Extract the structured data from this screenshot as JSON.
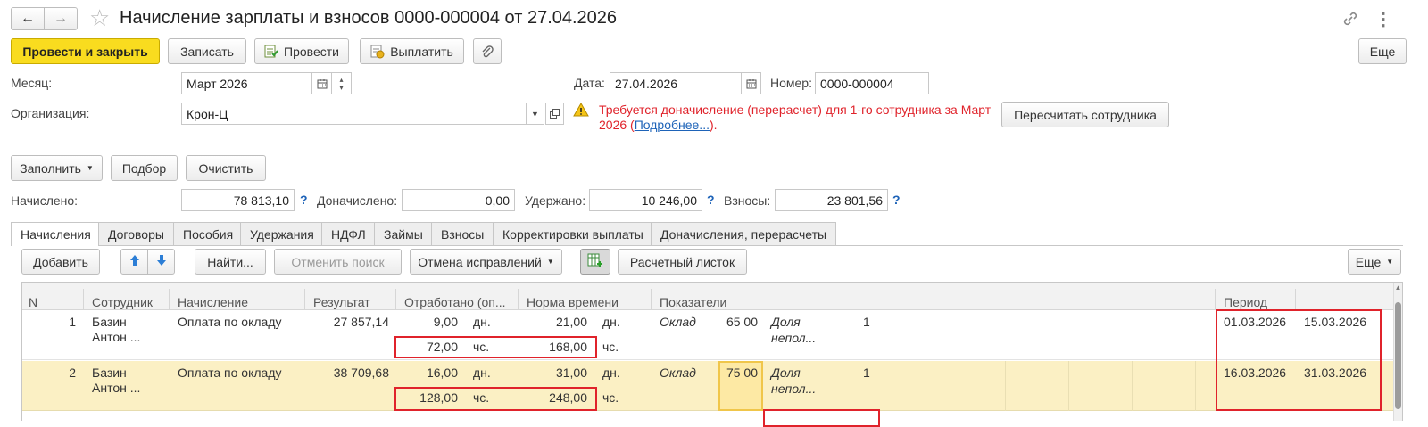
{
  "header": {
    "title": "Начисление зарплаты и взносов 0000-000004 от 27.04.2026",
    "back": "←",
    "forward": "→",
    "star": "☆",
    "link_icon": "link-icon",
    "more_icon": "⋮"
  },
  "toolbar": {
    "post_close": "Провести и закрыть",
    "save": "Записать",
    "post": "Провести",
    "pay": "Выплатить",
    "more": "Еще"
  },
  "form": {
    "month_label": "Месяц:",
    "month_value": "Март 2026",
    "date_label": "Дата:",
    "date_value": "27.04.2026",
    "number_label": "Номер:",
    "number_value": "0000-000004",
    "org_label": "Организация:",
    "org_value": "Крон-Ц",
    "warning_line1": "Требуется доначисление (перерасчет) для 1-го сотрудника за Март",
    "warning_line2_pre": "2026 (",
    "warning_link": "Подробнее...",
    "warning_line2_post": ").",
    "recalc_button": "Пересчитать сотрудника"
  },
  "actions": {
    "fill": "Заполнить",
    "pick": "Подбор",
    "clear": "Очистить"
  },
  "totals": {
    "accrued_label": "Начислено:",
    "accrued_value": "78 813,10",
    "extra_label": "Доначислено:",
    "extra_value": "0,00",
    "withheld_label": "Удержано:",
    "withheld_value": "10 246,00",
    "contrib_label": "Взносы:",
    "contrib_value": "23 801,56",
    "q": "?"
  },
  "tabs": [
    "Начисления",
    "Договоры",
    "Пособия",
    "Удержания",
    "НДФЛ",
    "Займы",
    "Взносы",
    "Корректировки выплаты",
    "Доначисления, перерасчеты"
  ],
  "table_toolbar": {
    "add": "Добавить",
    "find": "Найти...",
    "cancel_search": "Отменить поиск",
    "cancel_fix": "Отмена исправлений",
    "payslip": "Расчетный листок",
    "more": "Еще"
  },
  "columns": [
    "N",
    "Сотрудник",
    "Начисление",
    "Результат",
    "Отработано (оп...",
    "Норма времени",
    "Показатели",
    "Период"
  ],
  "rows": [
    {
      "n": "1",
      "employee_1": "Базин",
      "employee_2": "Антон ...",
      "accrual": "Оплата по окладу",
      "result": "27 857,14",
      "worked_days": "9,00",
      "days_unit": "дн.",
      "worked_hours": "72,00",
      "hours_unit": "чс.",
      "norm_days": "21,00",
      "norm_days_unit": "дн.",
      "norm_hours": "168,00",
      "norm_hours_unit": "чс.",
      "ind_name": "Оклад",
      "ind_value": "65 00",
      "share_1": "Доля",
      "share_2": "непол...",
      "share_value": "1",
      "period_from": "01.03.2026",
      "period_to": "15.03.2026"
    },
    {
      "n": "2",
      "employee_1": "Базин",
      "employee_2": "Антон ...",
      "accrual": "Оплата по окладу",
      "result": "38 709,68",
      "worked_days": "16,00",
      "days_unit": "дн.",
      "worked_hours": "128,00",
      "hours_unit": "чс.",
      "norm_days": "31,00",
      "norm_days_unit": "дн.",
      "norm_hours": "248,00",
      "norm_hours_unit": "чс.",
      "ind_name": "Оклад",
      "ind_value": "75 00",
      "share_1": "Доля",
      "share_2": "непол...",
      "share_value": "1",
      "period_from": "16.03.2026",
      "period_to": "31.03.2026"
    }
  ]
}
